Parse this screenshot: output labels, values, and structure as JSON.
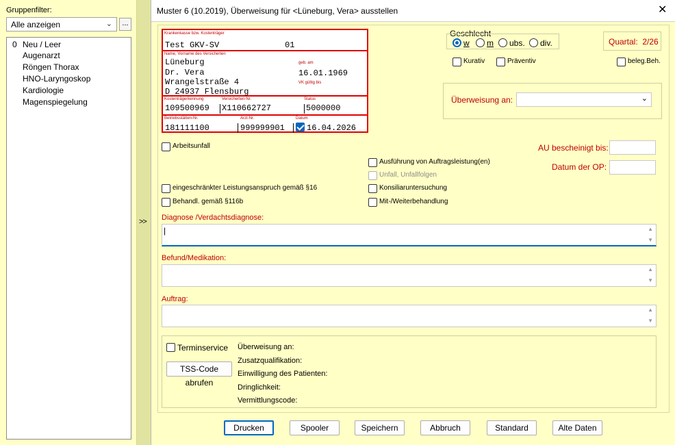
{
  "sidebar": {
    "filter_label": "Gruppenfilter:",
    "filter_value": "Alle anzeigen",
    "filter_btn": "...",
    "items": [
      {
        "num": "0",
        "label": "Neu / Leer"
      },
      {
        "num": "",
        "label": "Augenarzt"
      },
      {
        "num": "",
        "label": "Röngen Thorax"
      },
      {
        "num": "",
        "label": "HNO-Laryngoskop"
      },
      {
        "num": "",
        "label": "Kardiologie"
      },
      {
        "num": "",
        "label": "Magenspiegelung"
      }
    ],
    "splitter_glyph": ">>"
  },
  "dialog": {
    "title": "Muster 6 (10.2019), Überweisung für <Lüneburg, Vera> ausstellen",
    "close": "✕"
  },
  "card": {
    "kasse_label": "Krankenkasse bzw. Kostenträger",
    "kasse": "Test GKV-SV",
    "kasse_code": "01",
    "name_label": "Name, Vorname des Versicherten",
    "name1": "Lüneburg",
    "name2": "Dr. Vera",
    "street": "Wrangelstraße 4",
    "city": "D 24937 Flensburg",
    "geb_label": "geb. am",
    "geb": "16.01.1969",
    "vk_label": "VK gültig bis",
    "kk_label": "Kostenträgerkennung",
    "kk": "109500969",
    "vnr_label": "Versicherten-Nr.",
    "vnr": "X110662727",
    "status_label": "Status",
    "status": "5000000",
    "bsnr_label": "Betriebsstätten-Nr.",
    "bsnr": "181111100",
    "lanr_label": "Arzt-Nr.",
    "lanr": "999999901",
    "datum_label": "Datum",
    "datum": "16.04.2026"
  },
  "geschlecht": {
    "label": "Geschlecht",
    "options": [
      "w",
      "m",
      "ubs.",
      "div."
    ],
    "selected": "w"
  },
  "quartal": "Quartal:  2/26",
  "kurativ": "Kurativ",
  "praeventiv": "Präventiv",
  "beleg": "beleg.Beh.",
  "ueberweisung_an_label": "Überweisung an:",
  "ueberweisung_an_value": "",
  "arbeitsunfall": "Arbeitsunfall",
  "au_label": "AU bescheinigt bis:",
  "op_label": "Datum der OP:",
  "ausfuehrung": "Ausführung von Auftragsleistung(en)",
  "unfall": "Unfall, Unfallfolgen",
  "konsiliar": "Konsiliaruntersuchung",
  "mitweiter": "Mit-/Weiterbehandlung",
  "eingeschraenkt": "eingeschränkter Leistungsanspruch gemäß §16",
  "behandl": "Behandl. gemäß §116b",
  "diagnose_label": "Diagnose /Verdachtsdiagnose:",
  "diagnose_value": "|",
  "befund_label": "Befund/Medikation:",
  "auftrag_label": "Auftrag:",
  "tss": {
    "terminservice": "Terminservice",
    "code_btn": "TSS-Code abrufen",
    "rows": [
      "Überweisung an:",
      "Zusatzqualifikation:",
      "Einwilligung des Patienten:",
      "Dringlichkeit:",
      "Vermittlungscode:"
    ]
  },
  "buttons": {
    "drucken": "Drucken",
    "spooler": "Spooler",
    "speichern": "Speichern",
    "abbruch": "Abbruch",
    "standard": "Standard",
    "alte": "Alte Daten"
  },
  "colors": {
    "background": "#ffffc6",
    "accent_red": "#c00000",
    "accent_blue": "#0067c0"
  }
}
